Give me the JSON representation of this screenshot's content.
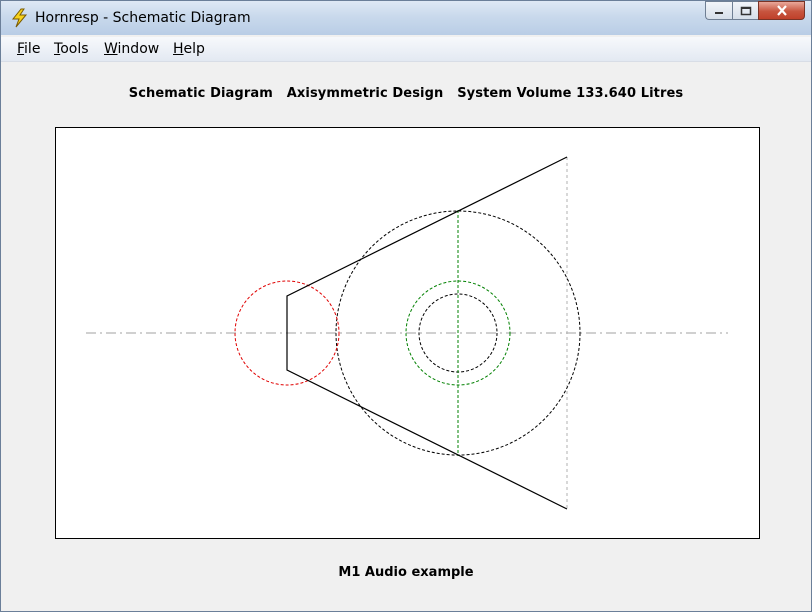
{
  "window": {
    "title": "Hornresp - Schematic Diagram"
  },
  "menu": {
    "file": {
      "accel": "F",
      "rest": "ile"
    },
    "tools": {
      "accel": "T",
      "rest": "ools"
    },
    "window": {
      "accel": "W",
      "rest": "indow"
    },
    "help": {
      "accel": "H",
      "rest": "elp"
    }
  },
  "diagram": {
    "heading": "Schematic Diagram   Axisymmetric Design   System Volume 133.640 Litres",
    "caption": "M1 Audio example"
  },
  "colors": {
    "driver_circle": "#e00000",
    "chamber_circle": "#008000",
    "outline": "#000000",
    "axis": "#a0a0a0"
  },
  "icons": {
    "app": "lightning-bolt-icon",
    "minimize": "minimize-icon",
    "maximize": "maximize-icon",
    "close": "close-icon"
  }
}
